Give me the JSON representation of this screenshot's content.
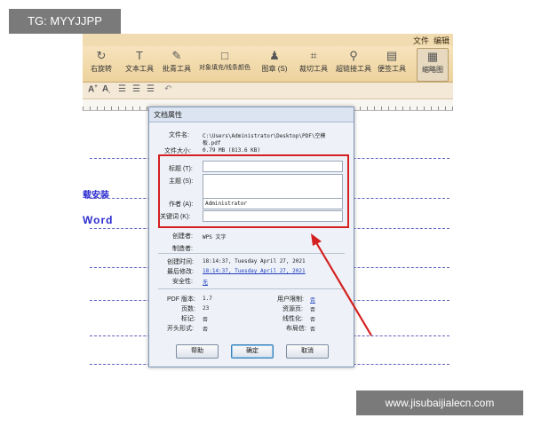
{
  "corner_labels": {
    "top_left": "TG: MYYJJPP",
    "bottom_right": "www.jisubaijialecn.com"
  },
  "menu": {
    "file": "文件",
    "edit": "编辑"
  },
  "toolbar": {
    "rotate": "右旋转",
    "text_tool": "文本工具",
    "note_tool": "批青工具",
    "obj_fill": "对象填充/线条颜色",
    "stamp": "图章 (S)",
    "crop": "裁切工具",
    "hyperlink": "超链接工具",
    "sticky": "便签工具",
    "thumbnail": "缩略图"
  },
  "document_snippets": {
    "l1": "载安装",
    "l2": "Word"
  },
  "dialog": {
    "title": "文档属性",
    "file_name_label": "文件名:",
    "file_name_value_1": "C:\\Users\\Administrator\\Desktop\\PDF\\空模",
    "file_name_value_2": "板.pdf",
    "file_size_label": "文件大小:",
    "file_size_value": "0.79 MB (813.6 KB)",
    "title_label": "标题 (T):",
    "title_value": "",
    "subject_label": "主题 (S):",
    "subject_value": "",
    "author_label": "作者 (A):",
    "author_value": "Administrator",
    "keywords_label": "关键词 (K):",
    "keywords_value": "",
    "creator_label": "创建者:",
    "creator_value": "WPS 文字",
    "producer_label": "制造者:",
    "producer_value": "",
    "created_label": "创建时间:",
    "created_value": "18:14:37, Tuesday April 27, 2021",
    "modified_label": "最后修改:",
    "modified_value": "18:14:37, Tuesday April 27, 2021",
    "security_label": "安全性:",
    "security_value": "无",
    "pdf_version_label": "PDF 版本:",
    "pdf_version_value": "1.7",
    "pages_label": "页数:",
    "pages_value": "23",
    "tagged_label": "标记:",
    "tagged_value": "否",
    "open_mode_label": "开头形式:",
    "open_mode_value": "否",
    "user_restrict_label": "用户限制:",
    "user_restrict_value": "否",
    "resources_label": "资源页:",
    "resources_value": "否",
    "linearized_label": "线性化:",
    "linearized_value": "否",
    "layout_label": "布局信:",
    "layout_value": "否",
    "help_button": "帮助",
    "ok_button": "确定",
    "cancel_button": "取消"
  },
  "colors": {
    "toolbar": "#ecd29c",
    "highlight": "#d42020",
    "doc_text": "#2b2bd0"
  }
}
